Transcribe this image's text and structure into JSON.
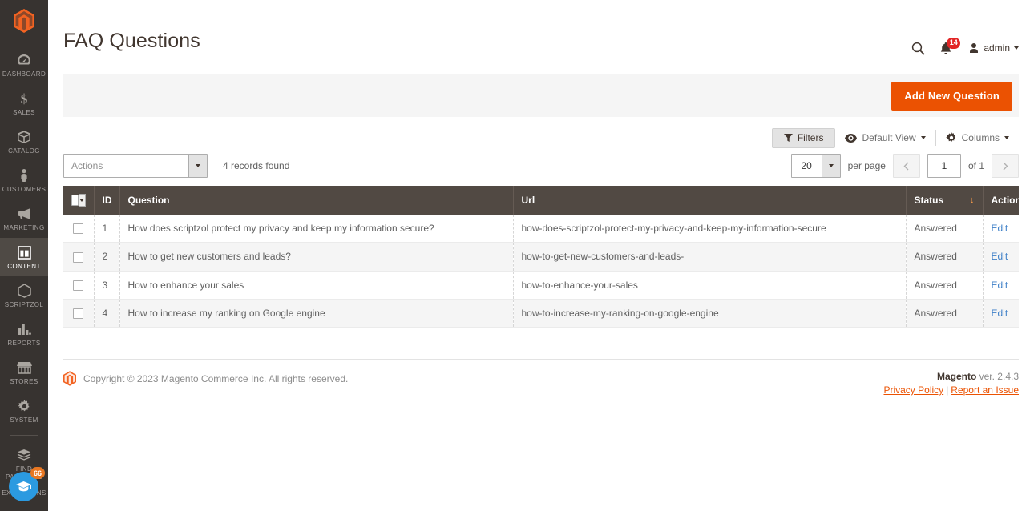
{
  "sidebar": {
    "logo": "magento-logo",
    "items": [
      {
        "label": "DASHBOARD",
        "icon": "dashboard-icon",
        "active": false
      },
      {
        "label": "SALES",
        "icon": "dollar-icon",
        "active": false
      },
      {
        "label": "CATALOG",
        "icon": "box-icon",
        "active": false
      },
      {
        "label": "CUSTOMERS",
        "icon": "person-icon",
        "active": false
      },
      {
        "label": "MARKETING",
        "icon": "megaphone-icon",
        "active": false
      },
      {
        "label": "CONTENT",
        "icon": "layout-icon",
        "active": true
      },
      {
        "label": "SCRIPTZOL",
        "icon": "hexagon-icon",
        "active": false
      },
      {
        "label": "REPORTS",
        "icon": "bar-chart-icon",
        "active": false
      },
      {
        "label": "STORES",
        "icon": "store-icon",
        "active": false
      },
      {
        "label": "SYSTEM",
        "icon": "gear-icon",
        "active": false
      },
      {
        "label": "FIND PARTNERS\n& EXTENSIONS",
        "icon": "puzzle-icon",
        "active": false
      }
    ],
    "find_partners_line1": "FIND PARTNERS",
    "find_partners_line2": "& EXTENSIONS",
    "help_button": {
      "icon": "graduation-cap-icon",
      "badge": "66",
      "badge_color": "#e87722",
      "color": "#2b9ae0"
    }
  },
  "header": {
    "title": "FAQ Questions",
    "search_icon": "search-icon",
    "notification_icon": "bell-icon",
    "notification_count": "14",
    "user_icon": "user-icon",
    "user_name": "admin"
  },
  "page_actions": {
    "add_new_button": "Add New Question",
    "accent_color": "#eb5202"
  },
  "grid_toolbar": {
    "filters_label": "Filters",
    "filters_icon": "funnel-icon",
    "view_icon": "eye-icon",
    "view_label": "Default View",
    "columns_icon": "gear-icon",
    "columns_label": "Columns"
  },
  "grid_controls": {
    "actions_placeholder": "Actions",
    "records_found": "4 records found",
    "per_page_value": "20",
    "per_page_label": "per page",
    "prev_icon": "chevron-left-icon",
    "next_icon": "chevron-right-icon",
    "page_value": "1",
    "of_label": "of 1"
  },
  "table": {
    "columns": [
      "ID",
      "Question",
      "Url",
      "Status",
      "Action"
    ],
    "sort_column": "Status",
    "sort_direction": "desc",
    "rows": [
      {
        "id": "1",
        "question": "How does scriptzol protect my privacy and keep my information secure?",
        "url": "how-does-scriptzol-protect-my-privacy-and-keep-my-information-secure",
        "status": "Answered",
        "action": "Edit"
      },
      {
        "id": "2",
        "question": "How to get new customers and leads?",
        "url": "how-to-get-new-customers-and-leads-",
        "status": "Answered",
        "action": "Edit"
      },
      {
        "id": "3",
        "question": "How to enhance your sales",
        "url": "how-to-enhance-your-sales",
        "status": "Answered",
        "action": "Edit"
      },
      {
        "id": "4",
        "question": "How to increase my ranking on Google engine",
        "url": "how-to-increase-my-ranking-on-google-engine",
        "status": "Answered",
        "action": "Edit"
      }
    ]
  },
  "footer": {
    "copyright": "Copyright © 2023 Magento Commerce Inc. All rights reserved.",
    "brand": "Magento",
    "version": " ver. 2.4.3",
    "privacy_policy": "Privacy Policy",
    "separator": "|",
    "report_issue": "Report an Issue"
  }
}
